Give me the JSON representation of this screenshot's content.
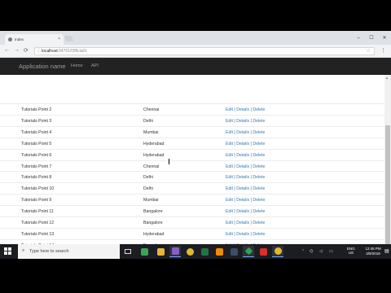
{
  "browser": {
    "tab_title": "Index",
    "tab_close": "×",
    "window_buttons": [
      "–",
      "☐",
      "✕"
    ],
    "address_host": "localhost",
    "address_path": ":54701/Official/1",
    "nav_icons": [
      "←",
      "→",
      "⟳"
    ]
  },
  "app": {
    "brand": "Application name",
    "nav": [
      "Home",
      "API"
    ]
  },
  "table": {
    "rows": [
      {
        "name": "Tutorials Point 2",
        "city": "Chennai"
      },
      {
        "name": "Tutorials Point 3",
        "city": "Delhi"
      },
      {
        "name": "Tutorials Point 4",
        "city": "Mumbai"
      },
      {
        "name": "Tutorials Point 5",
        "city": "Hyderabad"
      },
      {
        "name": "Tutorials Point 6",
        "city": "Hyderabad"
      },
      {
        "name": "Tutorials Point 7",
        "city": "Chennai"
      },
      {
        "name": "Tutorials Point 8",
        "city": "Delhi"
      },
      {
        "name": "Tutorials Point 10",
        "city": "Delhi"
      },
      {
        "name": "Tutorials Point 9",
        "city": "Mumbai"
      },
      {
        "name": "Tutorials Point 11",
        "city": "Bangalore"
      },
      {
        "name": "Tutorials Point 12",
        "city": "Bangalore"
      },
      {
        "name": "Tutorials Point 13",
        "city": "Hyderabad"
      },
      {
        "name": "Tutorials Point 14",
        "city": "Bangalore"
      },
      {
        "name": "Tutorials Point 15",
        "city": "Hyderabad"
      }
    ],
    "actions": {
      "edit": "Edit",
      "details": "Details",
      "delete": "Delete",
      "separator": "|"
    }
  },
  "taskbar": {
    "search_placeholder": "Type here to search",
    "language": "ENG",
    "language_sub": "US",
    "time": "12:45 PM",
    "date": "3/9/2018",
    "colors": {
      "accent": "#7aa7ff"
    }
  }
}
